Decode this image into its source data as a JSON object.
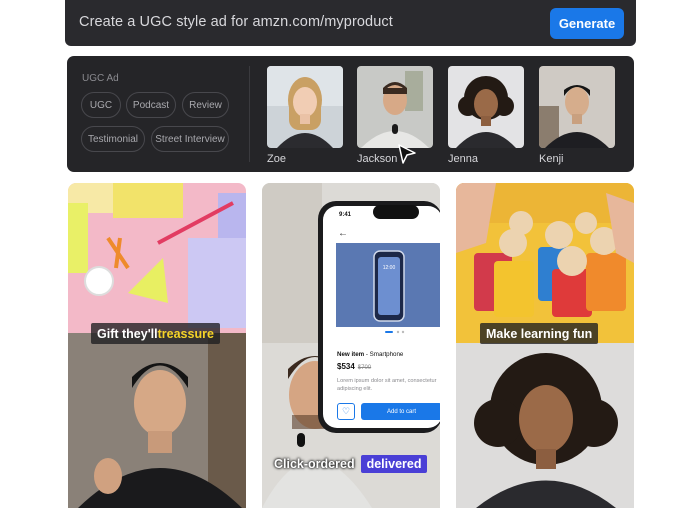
{
  "prompt": {
    "text": "Create a UGC style ad for amzn.com/myproduct",
    "generate_label": "Generate"
  },
  "ugc_panel": {
    "title": "UGC Ad",
    "chips": [
      "UGC",
      "Podcast",
      "Review",
      "Testimonial",
      "Street Interview"
    ],
    "avatars": [
      {
        "name": "Zoe"
      },
      {
        "name": "Jackson"
      },
      {
        "name": "Jenna"
      },
      {
        "name": "Kenji"
      }
    ]
  },
  "tiles": [
    {
      "caption_a": "Gift they'll ",
      "caption_b": "treassure"
    },
    {
      "caption_a": "Click-ordered",
      "caption_b": "delivered",
      "phone": {
        "time": "9:41",
        "item_title_bold": "New item",
        "item_title_rest": " - Smartphone",
        "price": "$534",
        "old_price": "$700",
        "lorem": "Lorem ipsum dolor sit amet, consectetur adipiscing elit.",
        "cart_label": "Add to cart",
        "screen_time": "12:00"
      }
    },
    {
      "caption": "Make learning fun"
    }
  ],
  "colors": {
    "accent_blue": "#1a78e8",
    "caption_yellow": "#f5d328",
    "caption_pill": "#4a3fd6"
  }
}
